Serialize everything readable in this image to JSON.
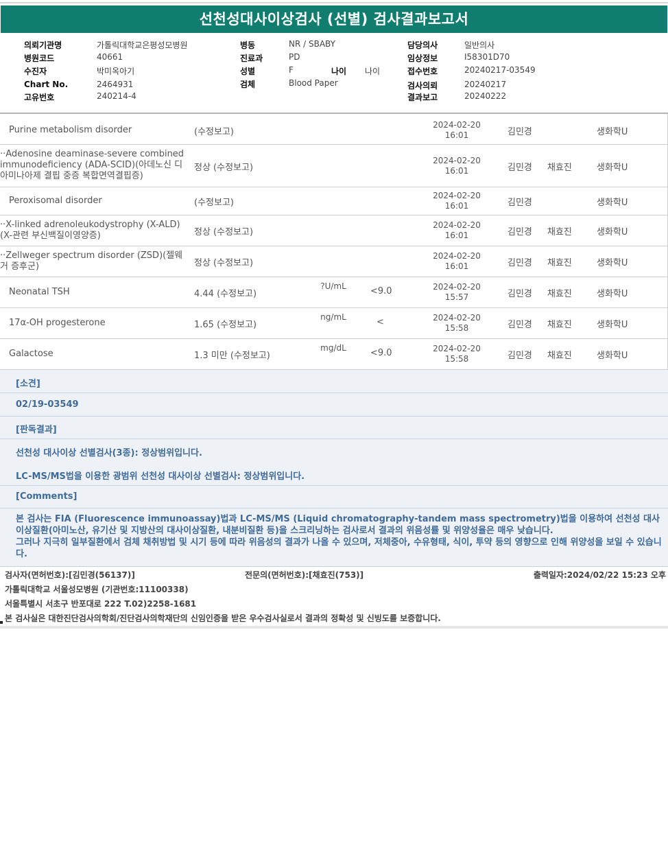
{
  "title": "선천성대사이상검사 (선별) 검사결과보고서",
  "info": {
    "col1": [
      {
        "label": "의뢰기관명",
        "value": "가톨릭대학교은평성모병원"
      },
      {
        "label": "병원코드",
        "value": "40661"
      },
      {
        "label": "수진자",
        "value": "박미옥아기"
      },
      {
        "label": "Chart No.",
        "value": "2464931"
      },
      {
        "label": "고유번호",
        "value": "240214-4"
      }
    ],
    "col2": [
      {
        "label": "병동",
        "value": "NR / SBABY"
      },
      {
        "label": "진료과",
        "value": "PD"
      },
      {
        "label": "성별",
        "value": "F"
      },
      {
        "label": "검체",
        "value": "Blood Paper"
      }
    ],
    "age": {
      "label": "나이",
      "value": "나이"
    },
    "col3": [
      {
        "label": "담당의사",
        "value": "일반의사"
      },
      {
        "label": "임상정보",
        "value": "I58301D70"
      },
      {
        "label": "접수번호",
        "value": "20240217-03549"
      },
      {
        "label": "검사의뢰",
        "value": "20240217"
      },
      {
        "label": "결과보고",
        "value": "20240222"
      }
    ]
  },
  "results": [
    {
      "name": "Purine metabolism disorder",
      "result": "(수정보고)",
      "unit": "",
      "ref": "",
      "date": "2024-02-20",
      "time": "16:01",
      "tester": "김민경",
      "verifier": "",
      "dept": "생화학U"
    },
    {
      "name": "··Adenosine deaminase-severe combined immunodeficiency (ADA-SCID)(아데노신 디아미나아제 결핍 중증 복합면역결핍증)",
      "result": "정상 (수정보고)",
      "unit": "",
      "ref": "",
      "date": "2024-02-20",
      "time": "16:01",
      "tester": "김민경",
      "verifier": "채효진",
      "dept": "생화학U"
    },
    {
      "name": "Peroxisomal disorder",
      "result": "(수정보고)",
      "unit": "",
      "ref": "",
      "date": "2024-02-20",
      "time": "16:01",
      "tester": "김민경",
      "verifier": "",
      "dept": "생화학U"
    },
    {
      "name": "··X-linked adrenoleukodystrophy (X-ALD)(X-관련 부신백질이영양증)",
      "result": "정상 (수정보고)",
      "unit": "",
      "ref": "",
      "date": "2024-02-20",
      "time": "16:01",
      "tester": "김민경",
      "verifier": "채효진",
      "dept": "생화학U"
    },
    {
      "name": "··Zellweger spectrum disorder (ZSD)(젤웨거 증후군)",
      "result": "정상 (수정보고)",
      "unit": "",
      "ref": "",
      "date": "2024-02-20",
      "time": "16:01",
      "tester": "김민경",
      "verifier": "채효진",
      "dept": "생화학U"
    },
    {
      "name": "Neonatal TSH",
      "result": "4.44 (수정보고)",
      "unit": "?U/mL",
      "ref": "<9.0",
      "date": "2024-02-20",
      "time": "15:57",
      "tester": "김민경",
      "verifier": "채효진",
      "dept": "생화학U"
    },
    {
      "name": "17α-OH progesterone",
      "result": "1.65 (수정보고)",
      "unit": "ng/mL",
      "ref": "<",
      "date": "2024-02-20",
      "time": "15:58",
      "tester": "김민경",
      "verifier": "채효진",
      "dept": "생화학U"
    },
    {
      "name": "Galactose",
      "result": "1.3 미만 (수정보고)",
      "unit": "mg/dL",
      "ref": "<9.0",
      "date": "2024-02-20",
      "time": "15:58",
      "tester": "김민경",
      "verifier": "채효진",
      "dept": "생화학U"
    }
  ],
  "notes": {
    "opinion_header": "[소견]",
    "opinion_text": "02/19-03549",
    "reading_header": "[판독결과]",
    "reading_line1": "선천성 대사이상 선별검사(3종): 정상범위입니다.",
    "reading_line2": "LC-MS/MS법을 이용한 광범위 선천성 대사이상 선별검사: 정상범위입니다.",
    "comments_header": "[Comments]",
    "comments_p1": "본 검사는 FIA (Fluorescence immunoassay)법과 LC-MS/MS (Liquid chromatography-tandem mass spectrometry)법을 이용하여 선천성 대사이상질환(아미노산, 유기산 및 지방산의 대사이상질환, 내분비질환 등)을 스크리닝하는 검사로서 결과의 위음성률 및 위양성율은 매우 낮습니다.",
    "comments_p2": "그러나 지극히 일부질환에서 검체 채취방법 및 시기 등에 따라 위음성의 결과가 나올 수 있으며, 저체중아, 수유형태, 식이, 투약 등의 영향으로 인해 위양성을 보일 수 있습니다."
  },
  "footer": {
    "examiner": "검사자(면허번호):[김민경(56137)]",
    "specialist": "전문의(면허번호):[채효진(753)]",
    "printed": "출력일자:2024/02/22 15:23 오후",
    "hospital": "가톨릭대학교 서울성모병원 (기관번호:11100338)",
    "address": "서울특별시 서초구 반포대로 222 T.02)2258-1681",
    "certification": "본 검사실은 대한진단검사의학회/진단검사의학재단의 신임인증을 받은 우수검사실로서 결과의 정확성 및 신빙도를 보증합니다."
  }
}
